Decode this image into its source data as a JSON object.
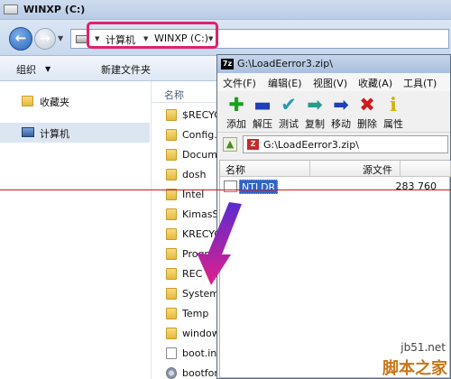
{
  "explorer": {
    "window_title": "WINXP (C:)",
    "breadcrumbs": [
      "计算机",
      "WINXP (C:)"
    ],
    "toolbar": {
      "organize": "组织",
      "new_folder": "新建文件夹"
    },
    "nav": {
      "favorites": "收藏夹",
      "computer": "计算机"
    },
    "column_name": "名称",
    "files": [
      {
        "name": "$RECYC",
        "icon": "folder-icon"
      },
      {
        "name": "Config.",
        "icon": "folder-icon"
      },
      {
        "name": "Docume",
        "icon": "folder-icon"
      },
      {
        "name": "dosh",
        "icon": "folder-icon"
      },
      {
        "name": "Intel",
        "icon": "folder-icon"
      },
      {
        "name": "KimasSy",
        "icon": "folder-icon"
      },
      {
        "name": "KRECYC",
        "icon": "folder-icon"
      },
      {
        "name": "Progra",
        "icon": "folder-icon"
      },
      {
        "name": "REC",
        "icon": "folder-icon"
      },
      {
        "name": "System",
        "icon": "folder-icon"
      },
      {
        "name": "Temp",
        "icon": "folder-icon"
      },
      {
        "name": "window",
        "icon": "folder-icon"
      },
      {
        "name": "boot.ini",
        "icon": "document-icon"
      },
      {
        "name": "bootfon",
        "icon": "settings-file-icon"
      }
    ]
  },
  "zip": {
    "window_title": "G:\\LoadEerror3.zip\\",
    "title_icon_text": "7z",
    "menu": [
      "文件(F)",
      "编辑(E)",
      "视图(V)",
      "收藏(A)",
      "工具(T)"
    ],
    "tools": [
      {
        "label": "添加",
        "icon": "add-icon",
        "glyph": "✚",
        "color": "#1aa31a"
      },
      {
        "label": "解压",
        "icon": "extract-icon",
        "glyph": "▬",
        "color": "#1d3fb8"
      },
      {
        "label": "测试",
        "icon": "test-icon",
        "glyph": "✔",
        "color": "#2a9ab0"
      },
      {
        "label": "复制",
        "icon": "copy-icon",
        "glyph": "➡",
        "color": "#2a9a8a"
      },
      {
        "label": "移动",
        "icon": "move-icon",
        "glyph": "➡",
        "color": "#1d3fb8"
      },
      {
        "label": "删除",
        "icon": "delete-icon",
        "glyph": "✖",
        "color": "#d21b1b"
      },
      {
        "label": "属性",
        "icon": "info-icon",
        "glyph": "ℹ",
        "color": "#d6b200"
      }
    ],
    "path": "G:\\LoadEerror3.zip\\",
    "path_icon_text": "Z",
    "columns": [
      "名称",
      "源文件"
    ],
    "rows": [
      {
        "name": "NTLDR",
        "size": "283 760"
      }
    ]
  },
  "watermark": {
    "url": "jb51.net",
    "brand": "脚本之家"
  },
  "colors": {
    "highlight": "#e0206e",
    "arrow": "#e0208a",
    "guide_line": "#d41a1a"
  }
}
